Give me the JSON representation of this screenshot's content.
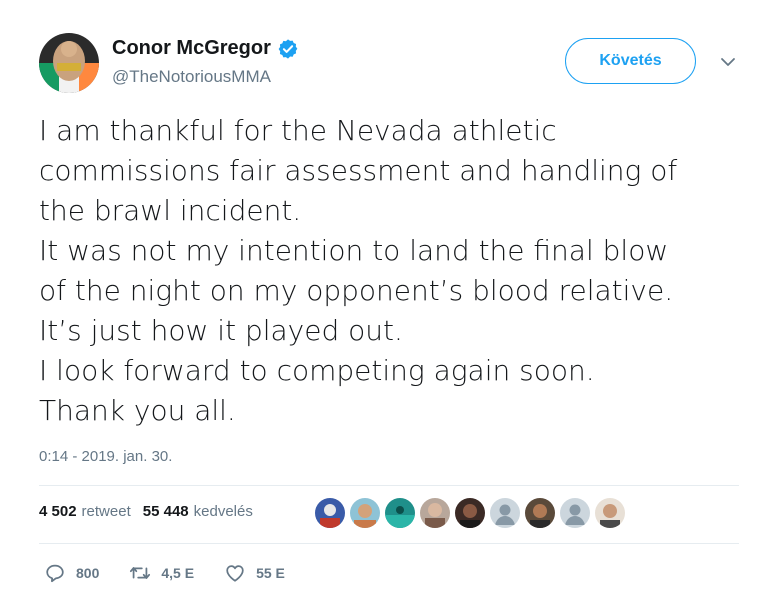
{
  "author": {
    "name": "Conor McGregor",
    "handle": "@TheNotoriousMMA",
    "verified": true
  },
  "follow_button": {
    "label": "Követés"
  },
  "tweet": {
    "lines": [
      "I am thankful for the Nevada athletic",
      "commissions fair assessment and handling of",
      "the brawl incident.",
      "It was not my intention to land the final blow",
      "of the night on my opponent’s blood relative.",
      "It’s just how it played out.",
      "I look forward to competing again soon.",
      "Thank you all."
    ],
    "timestamp": "0:14 - 2019. jan. 30."
  },
  "stats": {
    "retweets_count": "4 502",
    "retweets_label": "retweet",
    "likes_count": "55 448",
    "likes_label": "kedvelés"
  },
  "actions": {
    "reply_count": "800",
    "retweet_count": "4,5 E",
    "like_count": "55 E"
  },
  "colors": {
    "accent": "#1da1f2",
    "secondary_text": "#657786",
    "primary_text": "#14171a"
  }
}
